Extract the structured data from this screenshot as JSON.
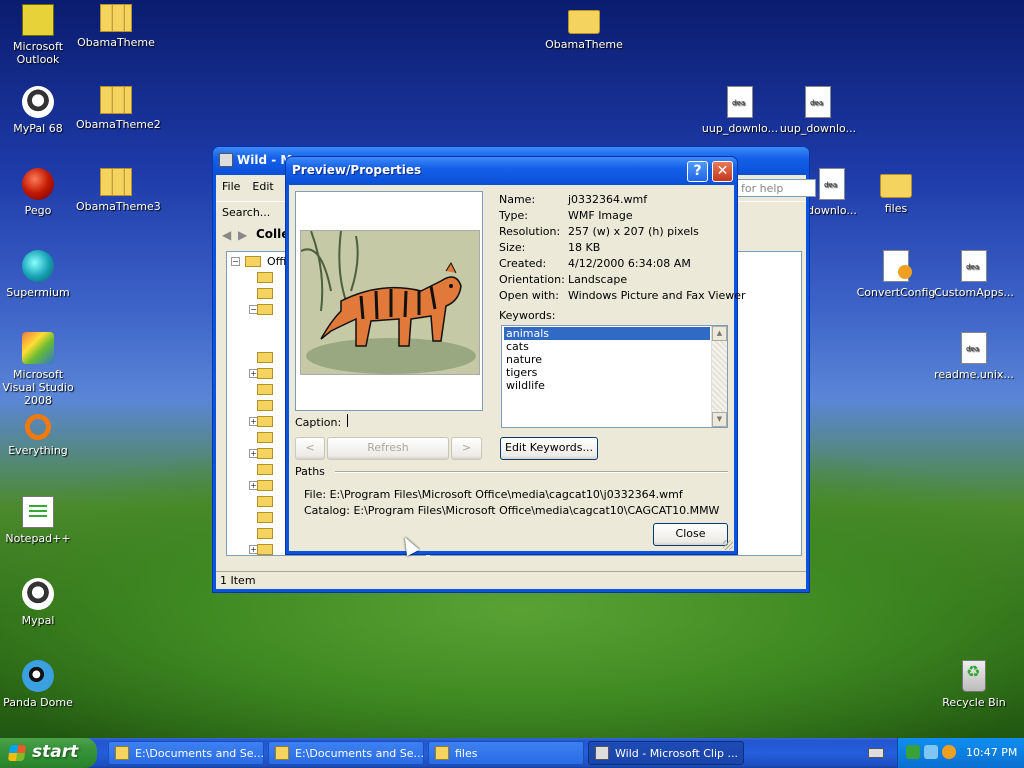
{
  "desktop": {
    "icons_left": [
      {
        "label": "Microsoft Outlook",
        "icon": "outlook-icon"
      },
      {
        "label": "ObamaTheme",
        "icon": "zip-folder-icon"
      },
      {
        "label": "MyPal 68",
        "icon": "raccoon-icon"
      },
      {
        "label": "ObamaTheme2",
        "icon": "zip-folder-icon"
      },
      {
        "label": "Pego",
        "icon": "red-ball-icon"
      },
      {
        "label": "ObamaTheme3",
        "icon": "zip-folder-icon"
      },
      {
        "label": "Supermium",
        "icon": "supermium-icon"
      },
      {
        "label": "Microsoft Visual Studio 2008",
        "icon": "visual-studio-icon"
      },
      {
        "label": "Everything",
        "icon": "everything-icon"
      },
      {
        "label": "Notepad++",
        "icon": "notepad-icon"
      },
      {
        "label": "Mypal",
        "icon": "raccoon-icon"
      },
      {
        "label": "Panda Dome",
        "icon": "panda-icon"
      }
    ],
    "icons_right": [
      {
        "label": "ObamaTheme",
        "icon": "folder-icon"
      },
      {
        "label": "uup_downlo...",
        "icon": "document-icon"
      },
      {
        "label": "uup_downlo...",
        "icon": "document-icon"
      },
      {
        "label": "downlo...",
        "icon": "gear-icon"
      },
      {
        "label": "files",
        "icon": "folder-icon"
      },
      {
        "label": "ConvertConfig",
        "icon": "config-icon"
      },
      {
        "label": "CustomApps...",
        "icon": "document-icon"
      },
      {
        "label": "readme.unix...",
        "icon": "document-icon"
      },
      {
        "label": "Recycle Bin",
        "icon": "recycle-bin-icon"
      }
    ]
  },
  "clip_window": {
    "title": "Wild - M",
    "menu": [
      "File",
      "Edit"
    ],
    "search_label": "Search...",
    "collections_label": "Colle",
    "tree_root_label": "Offic",
    "help_placeholder": "for help",
    "status": "1 Item"
  },
  "dialog": {
    "title": "Preview/Properties",
    "properties": [
      {
        "key": "Name:",
        "value": "j0332364.wmf"
      },
      {
        "key": "Type:",
        "value": "WMF Image"
      },
      {
        "key": "Resolution:",
        "value": "257 (w) x 207 (h) pixels"
      },
      {
        "key": "Size:",
        "value": "18 KB"
      },
      {
        "key": "Created:",
        "value": "4/12/2000 6:34:08 AM"
      },
      {
        "key": "Orientation:",
        "value": "Landscape"
      },
      {
        "key": "Open with:",
        "value": "Windows Picture and Fax Viewer"
      }
    ],
    "keywords_label": "Keywords:",
    "keywords": [
      "animals",
      "cats",
      "nature",
      "tigers",
      "wildlife"
    ],
    "selected_keyword": "animals",
    "caption_label": "Caption:",
    "caption_value": "",
    "prev_label": "<",
    "refresh_label": "Refresh",
    "next_label": ">",
    "edit_keywords_label": "Edit Keywords...",
    "paths_label": "Paths",
    "file_path": "File:  E:\\Program Files\\Microsoft Office\\media\\cagcat10\\j0332364.wmf",
    "catalog_path": "Catalog:  E:\\Program Files\\Microsoft Office\\media\\cagcat10\\CAGCAT10.MMW",
    "close_label": "Close"
  },
  "taskbar": {
    "start_label": "start",
    "tasks": [
      {
        "label": "E:\\Documents and Se...",
        "active": false
      },
      {
        "label": "E:\\Documents and Se...",
        "active": false
      },
      {
        "label": "files",
        "active": false
      },
      {
        "label": "Wild - Microsoft Clip ...",
        "active": true
      }
    ],
    "clock": "10:47 PM"
  },
  "colors": {
    "xp_blue": "#0a54e0",
    "selection": "#316ac5",
    "dialog_face": "#ece9d8",
    "start_green": "#37923a"
  }
}
